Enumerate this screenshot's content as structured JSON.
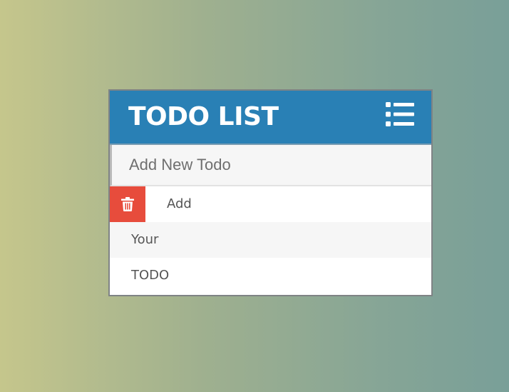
{
  "app": {
    "title": "TODO LIST",
    "header_color": "#2980b5",
    "delete_color": "#e74c3c",
    "menu_icon": "list-icon"
  },
  "input": {
    "placeholder": "Add New Todo",
    "value": ""
  },
  "todos": [
    {
      "label": "Add",
      "hovered": true,
      "delete_icon": "trash-icon"
    },
    {
      "label": "Your",
      "hovered": false
    },
    {
      "label": "TODO",
      "hovered": false
    }
  ]
}
